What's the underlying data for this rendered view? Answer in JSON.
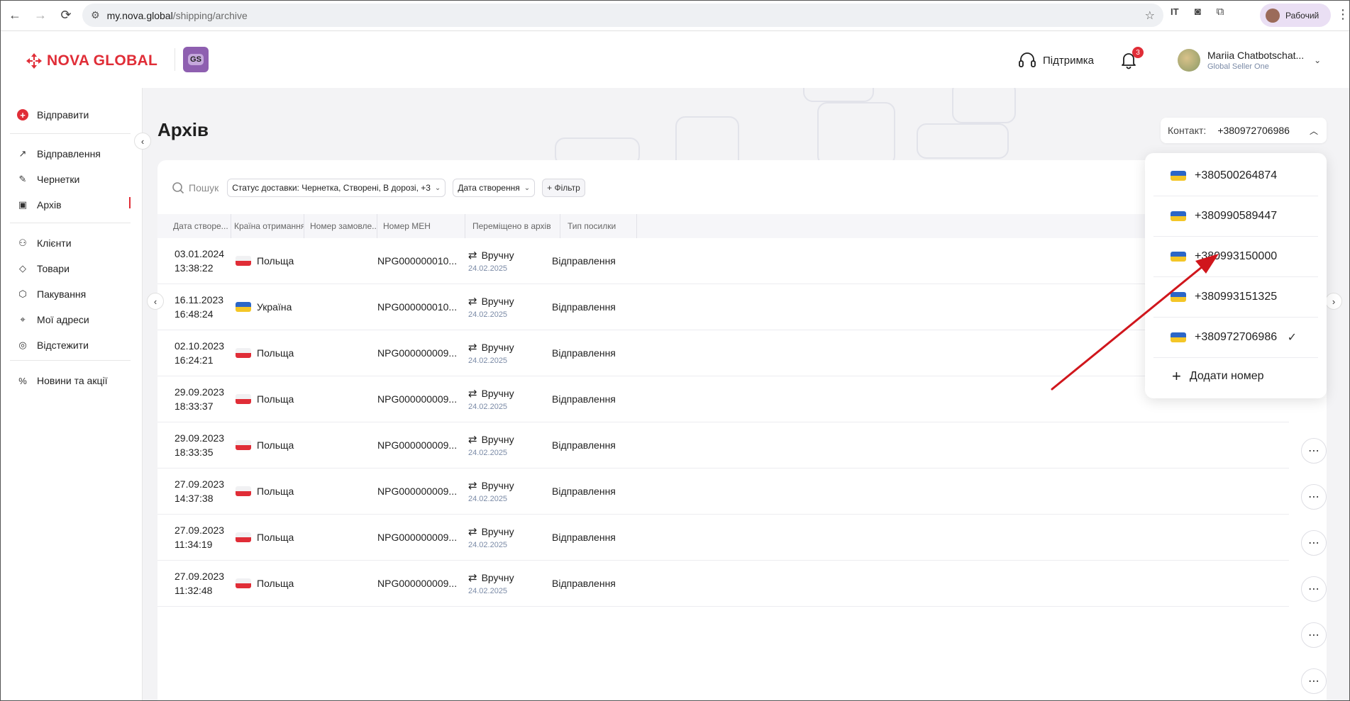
{
  "browser": {
    "url_host": "my.nova.global",
    "url_path": "/shipping/archive",
    "profile_label": "Рабочий"
  },
  "header": {
    "logo_text": "NOVA GLOBAL",
    "badge_text": "GS",
    "support_label": "Підтримка",
    "notifications_count": "3",
    "user_name": "Mariia Chatbotschat...",
    "user_role": "Global Seller One"
  },
  "sidebar": {
    "send_label": "Відправити",
    "items": [
      {
        "label": "Відправлення",
        "icon": "arrow-up-right-icon"
      },
      {
        "label": "Чернетки",
        "icon": "edit-icon"
      },
      {
        "label": "Архів",
        "icon": "archive-icon"
      },
      {
        "label": "Клієнти",
        "icon": "users-icon"
      },
      {
        "label": "Товари",
        "icon": "tag-icon"
      },
      {
        "label": "Пакування",
        "icon": "box-icon"
      },
      {
        "label": "Мої адреси",
        "icon": "location-icon"
      },
      {
        "label": "Відстежити",
        "icon": "track-icon"
      },
      {
        "label": "Новини та акції",
        "icon": "percent-icon"
      }
    ]
  },
  "page": {
    "title": "Архів",
    "contact_label": "Контакт:",
    "contact_value": "+380972706986"
  },
  "filters": {
    "search_placeholder": "Пошук",
    "status_chip": "Статус доставки: Чернетка, Створені, В дорозі, +3",
    "date_chip": "Дата створення",
    "add_filter": "+ Фільтр"
  },
  "table": {
    "columns": [
      "Дата створе...",
      "Країна отримання",
      "Номер замовле...",
      "Номер МЕН",
      "Переміщено в архів",
      "Тип посилки"
    ],
    "rows": [
      {
        "date": "03.01.2024",
        "time": "13:38:22",
        "country": "Польща",
        "flag": "pl",
        "men": "NPG000000010...",
        "archived": "Вручну",
        "archived_date": "24.02.2025",
        "type": "Відправлення"
      },
      {
        "date": "16.11.2023",
        "time": "16:48:24",
        "country": "Україна",
        "flag": "ua",
        "men": "NPG000000010...",
        "archived": "Вручну",
        "archived_date": "24.02.2025",
        "type": "Відправлення"
      },
      {
        "date": "02.10.2023",
        "time": "16:24:21",
        "country": "Польща",
        "flag": "pl",
        "men": "NPG000000009...",
        "archived": "Вручну",
        "archived_date": "24.02.2025",
        "type": "Відправлення"
      },
      {
        "date": "29.09.2023",
        "time": "18:33:37",
        "country": "Польща",
        "flag": "pl",
        "men": "NPG000000009...",
        "archived": "Вручну",
        "archived_date": "24.02.2025",
        "type": "Відправлення"
      },
      {
        "date": "29.09.2023",
        "time": "18:33:35",
        "country": "Польща",
        "flag": "pl",
        "men": "NPG000000009...",
        "archived": "Вручну",
        "archived_date": "24.02.2025",
        "type": "Відправлення"
      },
      {
        "date": "27.09.2023",
        "time": "14:37:38",
        "country": "Польща",
        "flag": "pl",
        "men": "NPG000000009...",
        "archived": "Вручну",
        "archived_date": "24.02.2025",
        "type": "Відправлення"
      },
      {
        "date": "27.09.2023",
        "time": "11:34:19",
        "country": "Польща",
        "flag": "pl",
        "men": "NPG000000009...",
        "archived": "Вручну",
        "archived_date": "24.02.2025",
        "type": "Відправлення"
      },
      {
        "date": "27.09.2023",
        "time": "11:32:48",
        "country": "Польща",
        "flag": "pl",
        "men": "NPG000000009...",
        "archived": "Вручну",
        "archived_date": "24.02.2025",
        "type": "Відправлення"
      }
    ]
  },
  "contact_dropdown": {
    "options": [
      {
        "phone": "+380500264874",
        "selected": false
      },
      {
        "phone": "+380990589447",
        "selected": false
      },
      {
        "phone": "+380993150000",
        "selected": false
      },
      {
        "phone": "+380993151325",
        "selected": false
      },
      {
        "phone": "+380972706986",
        "selected": true
      }
    ],
    "add_label": "Додати номер"
  },
  "colors": {
    "brand_red": "#e02d37",
    "annotation_arrow": "#d0161c"
  }
}
